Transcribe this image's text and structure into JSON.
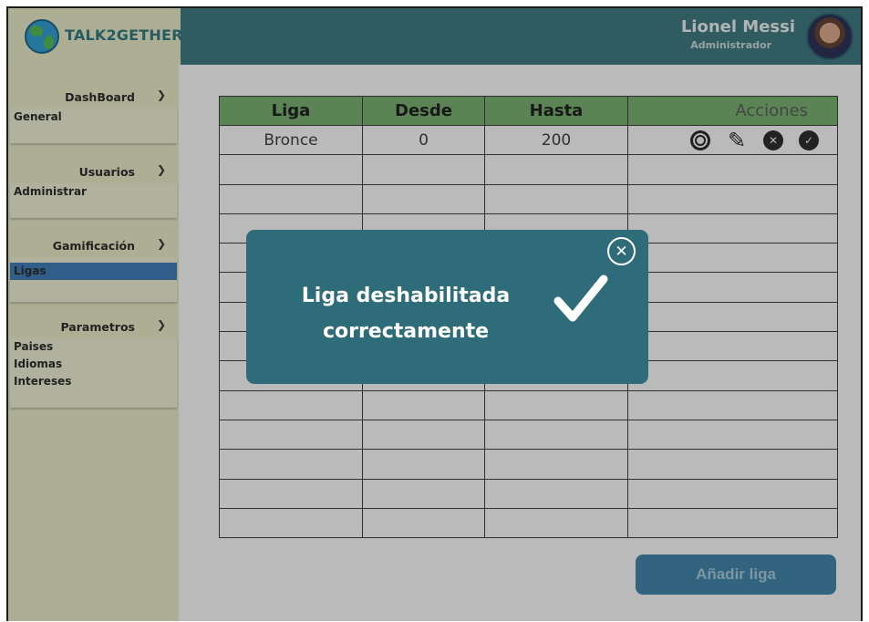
{
  "brand": {
    "name": "TALK2GETHER",
    "icon": "globe-icon"
  },
  "user": {
    "name": "Lionel Messi",
    "role": "Administrador"
  },
  "sidebar": {
    "sections": [
      {
        "label": "DashBoard",
        "items": [
          "General"
        ]
      },
      {
        "label": "Usuarios",
        "items": [
          "Administrar"
        ]
      },
      {
        "label": "Gamificación",
        "items": [
          "Ligas"
        ],
        "active": "Ligas"
      },
      {
        "label": "Parametros",
        "items": [
          "Paises",
          "Idiomas",
          "Intereses"
        ]
      }
    ]
  },
  "table": {
    "headers": [
      "Liga",
      "Desde",
      "Hasta",
      "Acciones"
    ],
    "rows": [
      {
        "liga": "Bronce",
        "desde": "0",
        "hasta": "200"
      }
    ],
    "action_icons": [
      "view-icon",
      "edit-icon",
      "disable-icon",
      "enable-icon"
    ]
  },
  "add_button": {
    "label": "Añadir liga"
  },
  "modal": {
    "message_line1": "Liga deshabilitada",
    "message_line2": "correctamente",
    "icon": "checkmark-icon",
    "close_icon": "close-icon"
  },
  "colors": {
    "header": "#3a6f77",
    "sidebar": "#d3d5b5",
    "table_header": "#6fa168",
    "modal": "#2e6c7a",
    "active_item": "#3b73a8",
    "button": "#3d7a9d"
  }
}
